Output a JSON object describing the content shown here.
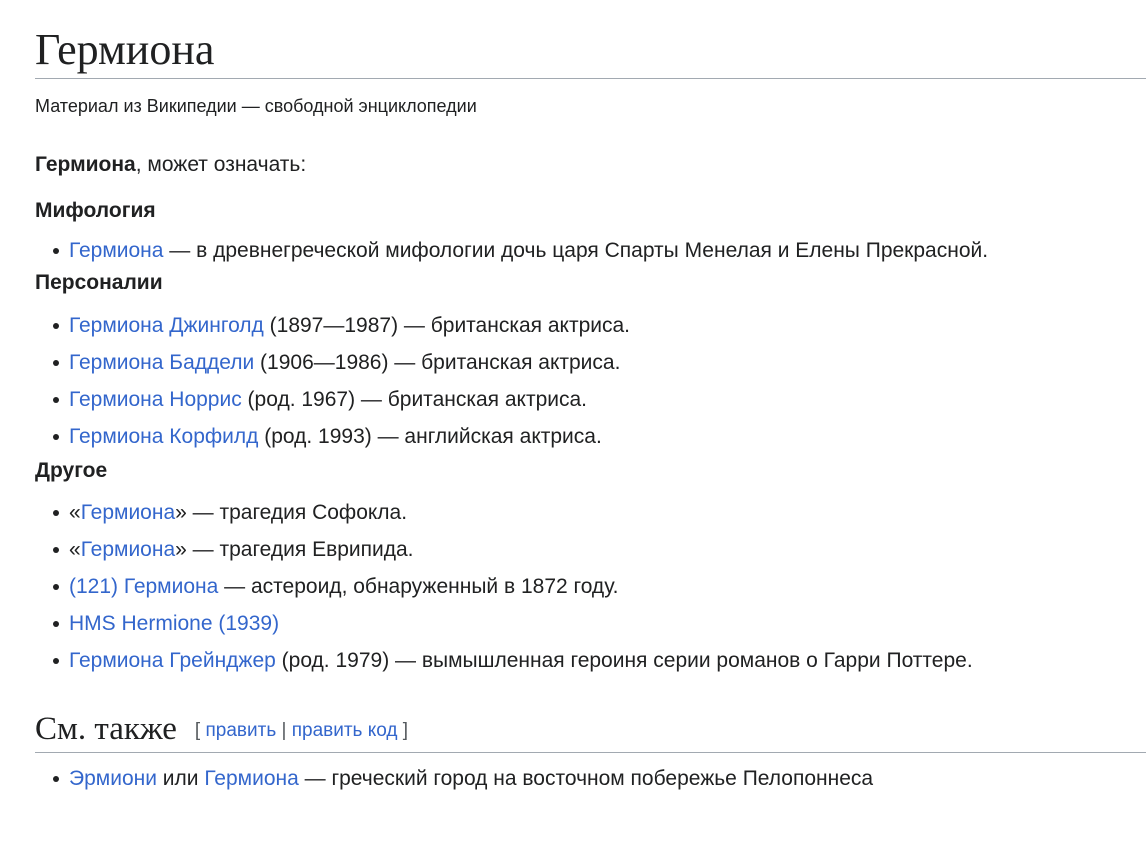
{
  "page": {
    "title": "Гермиона",
    "site_sub": "Материал из Википедии — свободной энциклопедии",
    "lead_bold": "Гермиона",
    "lead_rest": ", может означать:"
  },
  "sections": {
    "mythology": {
      "heading": "Мифология",
      "items": [
        {
          "link": "Гермиона",
          "text": " — в древнегреческой мифологии дочь царя Спарты Менелая и Елены Прекрасной."
        }
      ]
    },
    "persons": {
      "heading": "Персоналии",
      "items": [
        {
          "link": "Гермиона Джинголд",
          "text": " (1897—1987) — британская актриса."
        },
        {
          "link": "Гермиона Баддели",
          "text": " (1906—1986) — британская актриса."
        },
        {
          "link": "Гермиона Норрис",
          "text": " (род. 1967) — британская актриса."
        },
        {
          "link": "Гермиона Корфилд",
          "text": " (род. 1993) — английская актриса."
        }
      ]
    },
    "other": {
      "heading": "Другое",
      "items": [
        {
          "pre": "«",
          "link": "Гермиона",
          "text": "» — трагедия Софокла."
        },
        {
          "pre": "«",
          "link": "Гермиона",
          "text": "» — трагедия Еврипида."
        },
        {
          "pre": "",
          "link": "(121) Гермиона",
          "text": " — астероид, обнаруженный в 1872 году."
        },
        {
          "pre": "",
          "link": "HMS Hermione (1939)",
          "text": ""
        },
        {
          "pre": "",
          "link": "Гермиона Грейнджер",
          "text": " (род. 1979) — вымышленная героиня серии романов о Гарри Поттере."
        }
      ]
    },
    "see_also": {
      "heading": "См. также",
      "edit_open": "[",
      "edit_label": "править",
      "edit_sep": "|",
      "edit_code_label": "править код",
      "edit_close": "]",
      "items": [
        {
          "link1": "Эрмиони",
          "mid": " или ",
          "link2": "Гермиона",
          "text": " — греческий город на восточном побережье Пелопоннеса"
        }
      ]
    }
  },
  "colors": {
    "link": "#3366cc",
    "text": "#202122",
    "rule": "#a2a9b1"
  }
}
